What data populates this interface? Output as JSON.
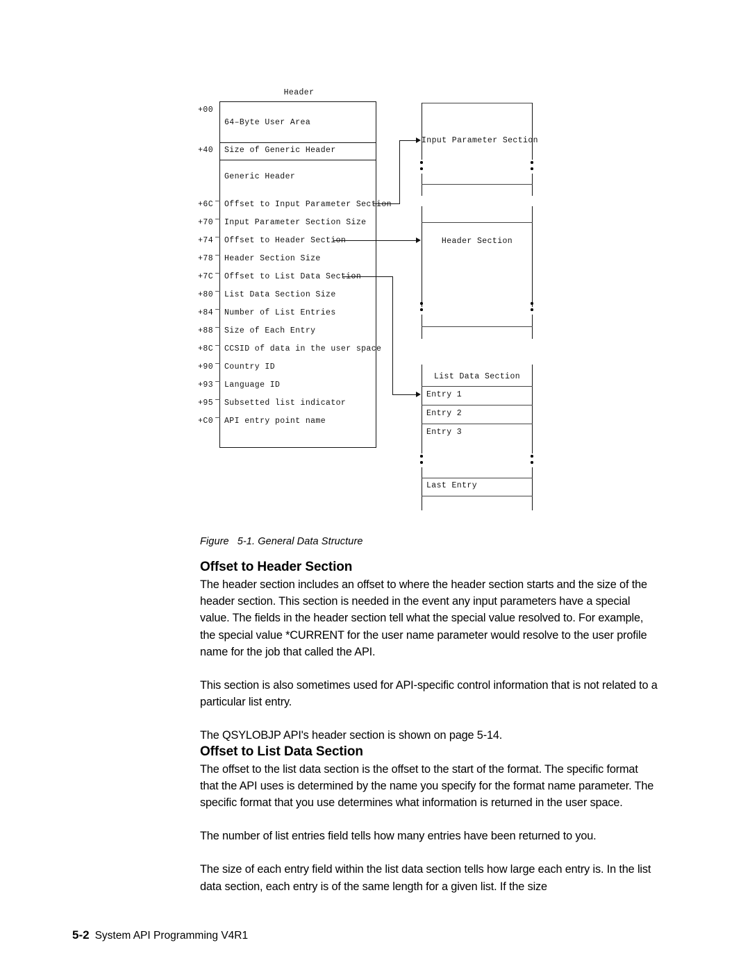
{
  "figure": {
    "caption_prefix": "Figure",
    "caption_number": "5-1.",
    "caption_title": "General Data Structure",
    "header_box": {
      "title": "Header",
      "fields": [
        {
          "offset": "+00",
          "label": "64–Byte User Area"
        },
        {
          "offset": "+40",
          "label": "Size of Generic Header"
        },
        {
          "offset": "",
          "label": "Generic Header"
        },
        {
          "offset": "+6C",
          "label": "Offset to Input Parameter Section"
        },
        {
          "offset": "+70",
          "label": "Input Parameter Section Size"
        },
        {
          "offset": "+74",
          "label": "Offset to Header Section"
        },
        {
          "offset": "+78",
          "label": "Header Section Size"
        },
        {
          "offset": "+7C",
          "label": "Offset to List Data Section"
        },
        {
          "offset": "+80",
          "label": "List Data Section Size"
        },
        {
          "offset": "+84",
          "label": "Number of List Entries"
        },
        {
          "offset": "+88",
          "label": "Size of Each Entry"
        },
        {
          "offset": "+8C",
          "label": "CCSID of data in the user space"
        },
        {
          "offset": "+90",
          "label": "Country ID"
        },
        {
          "offset": "+93",
          "label": "Language ID"
        },
        {
          "offset": "+95",
          "label": "Subsetted list indicator"
        },
        {
          "offset": "+C0",
          "label": "API entry point name"
        }
      ]
    },
    "sections": [
      {
        "name": "input_parameter_section",
        "label": "Input Parameter Section"
      },
      {
        "name": "header_section",
        "label": "Header Section"
      },
      {
        "name": "list_data_section",
        "label": "List Data Section"
      }
    ],
    "list_entries": [
      {
        "label": "Entry 1"
      },
      {
        "label": "Entry 2"
      },
      {
        "label": "Entry 3"
      },
      {
        "label": "Last Entry"
      }
    ]
  },
  "content": {
    "heading_1": "Offset to Header Section",
    "para_1": "The header section includes an offset to where the header section starts and the size of the header section.  This section is needed in the event any input parameters have a special value.  The fields in the header section tell what the special value resolved to.  For example, the special value *CURRENT for the user name parameter would resolve to the user profile name for the job that called the API.",
    "para_2": "This section is also sometimes used for API-specific control information that is not related to a particular list entry.",
    "para_3": "The QSYLOBJP API's header section is shown on page 5-14.",
    "heading_2": "Offset to List Data Section",
    "para_4": "The offset to the list data section is the offset to the start of the format.  The specific format that the API uses is determined by the name you specify for the format name parameter.  The specific format that you use determines what information is returned in the user space.",
    "para_5": "The number of list entries field tells how many entries have been returned to you.",
    "para_6": "The size of each entry field within the list data section tells how large each entry is.  In the list data section, each entry is of the same length for a given list.  If the size"
  },
  "footer": {
    "page_number": "5-2",
    "book_title": "System API Programming V4R1"
  }
}
